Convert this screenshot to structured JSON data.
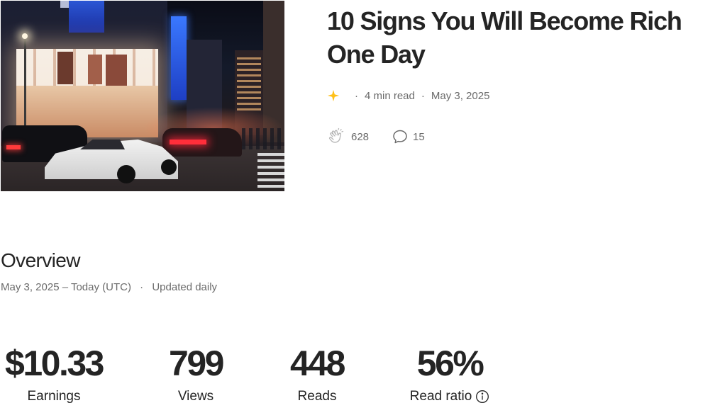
{
  "article": {
    "title": "10 Signs You Will Become Rich One Day",
    "read_time": "4 min read",
    "date": "May 3, 2025",
    "member_only_icon": "sparkle-icon",
    "claps": "628",
    "responses": "15",
    "image_alt": "Night city street with white sports car"
  },
  "overview": {
    "title": "Overview",
    "date_range": "May 3, 2025 – Today (UTC)",
    "separator": "·",
    "update_note": "Updated daily"
  },
  "metrics": [
    {
      "value": "$10.33",
      "label": "Earnings"
    },
    {
      "value": "799",
      "label": "Views"
    },
    {
      "value": "448",
      "label": "Reads"
    },
    {
      "value": "56%",
      "label": "Read ratio"
    }
  ],
  "colors": {
    "text": "#242424",
    "muted": "#6b6b6b",
    "sparkle": "#ffc017"
  }
}
